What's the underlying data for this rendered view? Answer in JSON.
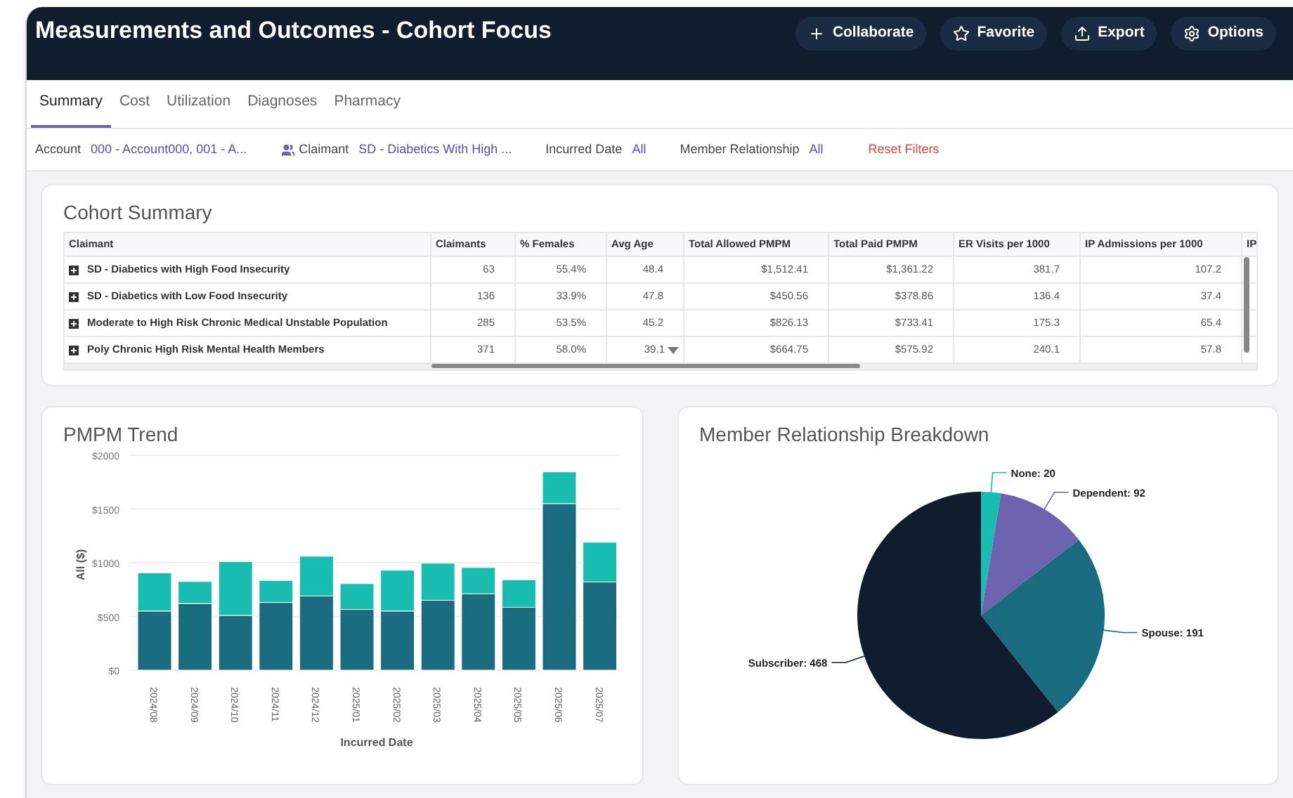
{
  "header": {
    "title": "Measurements and Outcomes - Cohort Focus",
    "buttons": [
      {
        "kind": "plus",
        "label": "Collaborate"
      },
      {
        "kind": "star",
        "label": "Favorite"
      },
      {
        "kind": "export",
        "label": "Export"
      },
      {
        "kind": "settings",
        "label": "Options"
      }
    ]
  },
  "tabs": [
    {
      "label": "Summary",
      "selected": true
    },
    {
      "label": "Cost",
      "selected": false
    },
    {
      "label": "Utilization",
      "selected": false
    },
    {
      "label": "Diagnoses",
      "selected": false
    },
    {
      "label": "Pharmacy",
      "selected": false
    }
  ],
  "filters": [
    {
      "kind": "plain",
      "label": "Account",
      "value": "000 - Account000, 001 - A..."
    },
    {
      "kind": "people",
      "label": "Claimant",
      "value": "SD - Diabetics With High ..."
    },
    {
      "kind": "plain",
      "label": "Incurred Date",
      "value": "All"
    },
    {
      "kind": "plain",
      "label": "Member Relationship",
      "value": "All"
    }
  ],
  "reset_filters": "Reset Filters",
  "cohort_summary": {
    "title": "Cohort Summary",
    "columns": [
      "Claimant",
      "Claimants",
      "% Females",
      "Avg Age",
      "Total Allowed PMPM",
      "Total Paid PMPM",
      "ER Visits per 1000",
      "IP Admissions per 1000",
      "IP"
    ],
    "rows": [
      {
        "kind": "plain",
        "cells": [
          "SD - Diabetics with High Food Insecurity",
          "63",
          "55.4%",
          "48.4",
          "$1,512.41",
          "$1,361.22",
          "381.7",
          "107.2"
        ]
      },
      {
        "kind": "plain",
        "cells": [
          "SD - Diabetics with Low Food Insecurity",
          "136",
          "33.9%",
          "47.8",
          "$450.56",
          "$378.86",
          "136.4",
          "37.4"
        ]
      },
      {
        "kind": "plain",
        "cells": [
          "Moderate to High Risk Chronic Medical Unstable Population",
          "285",
          "53.5%",
          "45.2",
          "$826.13",
          "$733.41",
          "175.3",
          "65.4"
        ]
      },
      {
        "kind": "menu",
        "cells": [
          "Poly Chronic High Risk Mental Health Members",
          "371",
          "58.0%",
          "39.1",
          "$664.75",
          "$575.92",
          "240.1",
          "57.8"
        ]
      }
    ]
  },
  "pmpm_trend": {
    "title": "PMPM Trend",
    "chart_data": {
      "type": "bar",
      "stacked": true,
      "xlabel": "Incurred Date",
      "ylabel": "All ($)",
      "categories": [
        "2024/08",
        "2024/09",
        "2024/10",
        "2024/11",
        "2024/12",
        "2025/01",
        "2025/02",
        "2025/03",
        "2025/04",
        "2025/05",
        "2025/06",
        "2025/07"
      ],
      "ylim": [
        0,
        2000
      ],
      "yticks": [
        {
          "value": 0,
          "label": "$0"
        },
        {
          "value": 500,
          "label": "$500"
        },
        {
          "value": 1000,
          "label": "$1000"
        },
        {
          "value": 1500,
          "label": "$1500"
        },
        {
          "value": 2000,
          "label": "$2000"
        }
      ],
      "series": [
        {
          "color": "#1a6a80",
          "values": [
            550,
            620,
            510,
            630,
            690,
            565,
            550,
            650,
            710,
            585,
            1550,
            820
          ]
        },
        {
          "color": "#19bcb1",
          "values": [
            355,
            205,
            500,
            205,
            370,
            240,
            380,
            345,
            245,
            255,
            295,
            370
          ]
        }
      ],
      "grid": true
    }
  },
  "member_relationship": {
    "title": "Member Relationship Breakdown",
    "chart_data": {
      "type": "pie",
      "values": [
        20,
        92,
        191,
        468
      ],
      "value_labels": [
        "None: 20",
        "Dependent: 92",
        "Spouse: 191",
        "Subscriber: 468"
      ]
    }
  }
}
